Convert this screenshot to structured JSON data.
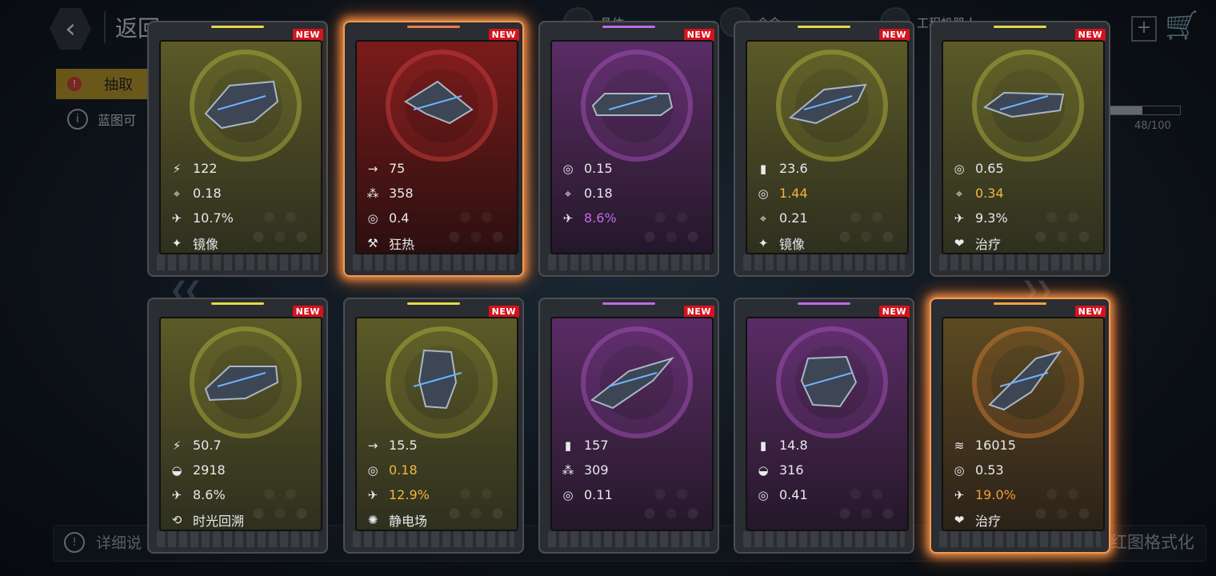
{
  "header": {
    "back_label": "返回",
    "resources": [
      {
        "label": "晶体"
      },
      {
        "label": "合金"
      },
      {
        "label": "工程机器人"
      }
    ]
  },
  "tab": {
    "label": "抽取"
  },
  "info": {
    "text": "蓝图可"
  },
  "progress": {
    "text": "48/100",
    "value": 0.48
  },
  "footer": {
    "left_text": "详细说",
    "right_text": "红图格式化"
  },
  "cards": [
    {
      "rarity": "yellow",
      "badge": "NEW",
      "glow": false,
      "stats": [
        {
          "icon": "damage-icon",
          "glyph": "⚡",
          "value": "122",
          "tone": ""
        },
        {
          "icon": "crosshair-icon",
          "glyph": "⌖",
          "value": "0.18",
          "tone": ""
        },
        {
          "icon": "rocket-icon",
          "glyph": "✈",
          "value": "10.7%",
          "tone": ""
        },
        {
          "icon": "mirror-skill-icon",
          "glyph": "✦",
          "value": "镜像",
          "tone": ""
        }
      ]
    },
    {
      "rarity": "red",
      "badge": "NEW",
      "glow": true,
      "stats": [
        {
          "icon": "speed-arrow-icon",
          "glyph": "→",
          "value": "75",
          "tone": ""
        },
        {
          "icon": "cluster-icon",
          "glyph": "⁂",
          "value": "358",
          "tone": ""
        },
        {
          "icon": "gear-icon",
          "glyph": "◎",
          "value": "0.4",
          "tone": ""
        },
        {
          "icon": "frenzy-skill-icon",
          "glyph": "⚒",
          "value": "狂热",
          "tone": ""
        }
      ]
    },
    {
      "rarity": "purple",
      "badge": "NEW",
      "glow": false,
      "stats": [
        {
          "icon": "gear-icon",
          "glyph": "◎",
          "value": "0.15",
          "tone": ""
        },
        {
          "icon": "crosshair-icon",
          "glyph": "⌖",
          "value": "0.18",
          "tone": ""
        },
        {
          "icon": "rocket-icon",
          "glyph": "✈",
          "value": "8.6%",
          "tone": "p"
        }
      ]
    },
    {
      "rarity": "yellow",
      "badge": "NEW",
      "glow": false,
      "stats": [
        {
          "icon": "ammo-icon",
          "glyph": "▮",
          "value": "23.6",
          "tone": ""
        },
        {
          "icon": "gear-icon",
          "glyph": "◎",
          "value": "1.44",
          "tone": "y"
        },
        {
          "icon": "crosshair-icon",
          "glyph": "⌖",
          "value": "0.21",
          "tone": ""
        },
        {
          "icon": "mirror-skill-icon",
          "glyph": "✦",
          "value": "镜像",
          "tone": ""
        }
      ]
    },
    {
      "rarity": "yellow",
      "badge": "NEW",
      "glow": false,
      "stats": [
        {
          "icon": "gear-icon",
          "glyph": "◎",
          "value": "0.65",
          "tone": ""
        },
        {
          "icon": "crosshair-icon",
          "glyph": "⌖",
          "value": "0.34",
          "tone": "y"
        },
        {
          "icon": "rocket-icon",
          "glyph": "✈",
          "value": "9.3%",
          "tone": ""
        },
        {
          "icon": "heal-skill-icon",
          "glyph": "❤",
          "value": "治疗",
          "tone": ""
        }
      ]
    },
    {
      "rarity": "yellow",
      "badge": "NEW",
      "glow": false,
      "stats": [
        {
          "icon": "damage-icon",
          "glyph": "⚡",
          "value": "50.7",
          "tone": ""
        },
        {
          "icon": "shield-icon",
          "glyph": "◒",
          "value": "2918",
          "tone": ""
        },
        {
          "icon": "rocket-icon",
          "glyph": "✈",
          "value": "8.6%",
          "tone": ""
        },
        {
          "icon": "time-rewind-skill-icon",
          "glyph": "⟲",
          "value": "时光回溯",
          "tone": ""
        }
      ]
    },
    {
      "rarity": "yellow",
      "badge": "NEW",
      "glow": false,
      "stats": [
        {
          "icon": "speed-arrow-icon",
          "glyph": "→",
          "value": "15.5",
          "tone": ""
        },
        {
          "icon": "gear-icon",
          "glyph": "◎",
          "value": "0.18",
          "tone": "y"
        },
        {
          "icon": "rocket-icon",
          "glyph": "✈",
          "value": "12.9%",
          "tone": "y"
        },
        {
          "icon": "static-field-skill-icon",
          "glyph": "✺",
          "value": "静电场",
          "tone": ""
        }
      ]
    },
    {
      "rarity": "purple",
      "badge": "NEW",
      "glow": false,
      "stats": [
        {
          "icon": "ammo-icon",
          "glyph": "▮",
          "value": "157",
          "tone": ""
        },
        {
          "icon": "cluster-icon",
          "glyph": "⁂",
          "value": "309",
          "tone": ""
        },
        {
          "icon": "gear-icon",
          "glyph": "◎",
          "value": "0.11",
          "tone": ""
        }
      ]
    },
    {
      "rarity": "purple",
      "badge": "NEW",
      "glow": false,
      "stats": [
        {
          "icon": "ammo-icon",
          "glyph": "▮",
          "value": "14.8",
          "tone": ""
        },
        {
          "icon": "shield-icon",
          "glyph": "◒",
          "value": "316",
          "tone": ""
        },
        {
          "icon": "gear-icon",
          "glyph": "◎",
          "value": "0.41",
          "tone": ""
        }
      ]
    },
    {
      "rarity": "orange",
      "badge": "NEW",
      "glow": true,
      "stats": [
        {
          "icon": "fleet-icon",
          "glyph": "≋",
          "value": "16015",
          "tone": ""
        },
        {
          "icon": "gear-icon",
          "glyph": "◎",
          "value": "0.53",
          "tone": ""
        },
        {
          "icon": "rocket-icon",
          "glyph": "✈",
          "value": "19.0%",
          "tone": "o"
        },
        {
          "icon": "heal-skill-icon",
          "glyph": "❤",
          "value": "治疗",
          "tone": ""
        }
      ]
    }
  ],
  "colors": {
    "yellow": "#e6d84a",
    "red": "#f07a50",
    "purple": "#c06be8",
    "orange": "#f5a040"
  }
}
